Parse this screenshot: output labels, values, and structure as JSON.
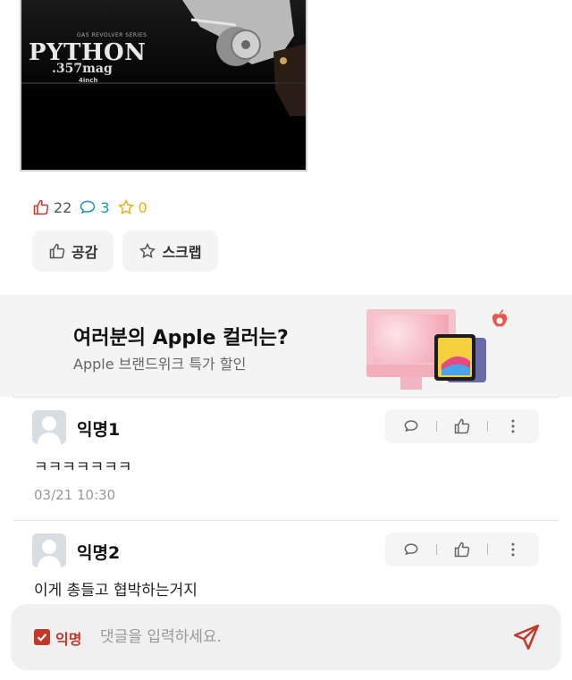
{
  "post_image": {
    "tiny_text": "GAS REVOLVER SERIES",
    "brand": "PYTHON",
    "caliber": ".357mag",
    "barrel": "4inch"
  },
  "stats": {
    "likes": "22",
    "comments": "3",
    "scraps": "0"
  },
  "actions": {
    "like_label": "공감",
    "scrap_label": "스크랩"
  },
  "ad": {
    "title": "여러분의 Apple 컬러는?",
    "subtitle": "Apple 브랜드위크 특가 할인"
  },
  "comments": [
    {
      "author": "익명1",
      "text": "ㅋㅋㅋㅋㅋㅋㅋ",
      "date": "03/21 10:30"
    },
    {
      "author": "익명2",
      "text": "이게 총들고 협박하는거지"
    }
  ],
  "input": {
    "anonymous_label": "익명",
    "placeholder": "댓글을 입력하세요."
  },
  "colors": {
    "accent": "#c0392b",
    "comment": "#1a8fb5",
    "star": "#e3b21a"
  }
}
